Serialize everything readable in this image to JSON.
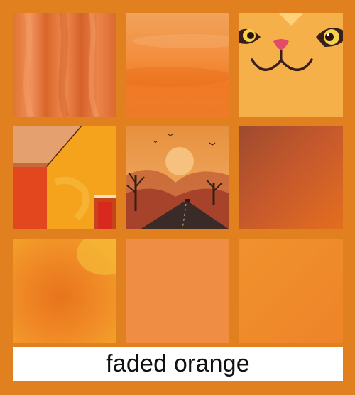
{
  "colors": {
    "background": "#E1801F",
    "caption_background": "#FFFFFF",
    "caption_text": "#111111"
  },
  "caption": {
    "text": "faded orange"
  },
  "tiles": [
    {
      "name": "silk-fabric-swatch",
      "icon": "fabric-texture"
    },
    {
      "name": "watercolor-sky-swatch",
      "icon": "watercolor-texture"
    },
    {
      "name": "cartoon-cat-face-tile",
      "icon": "cat-face-icon"
    },
    {
      "name": "orange-barn-tile",
      "icon": "barn-icon"
    },
    {
      "name": "sunset-road-tile",
      "icon": "sunset-landscape"
    },
    {
      "name": "rust-gradient-swatch",
      "icon": "gradient-texture"
    },
    {
      "name": "blurred-orange-swatch",
      "icon": "gradient-texture"
    },
    {
      "name": "flat-orange-swatch",
      "icon": "solid-color"
    },
    {
      "name": "soft-orange-swatch",
      "icon": "solid-color"
    }
  ]
}
